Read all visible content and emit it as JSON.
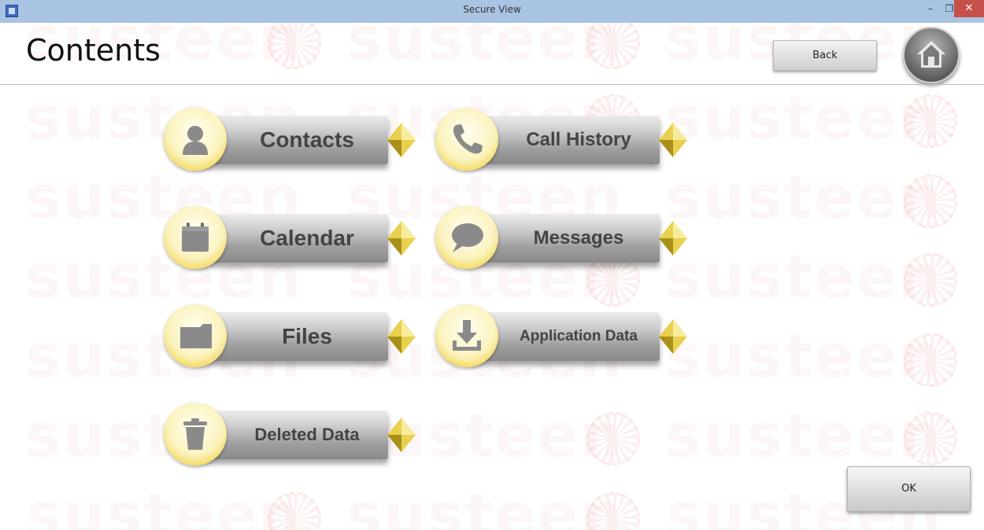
{
  "window": {
    "title": "Secure View",
    "minimize_glyph": "–",
    "maximize_glyph": "❐",
    "close_glyph": "✕"
  },
  "header": {
    "title": "Contents",
    "back_label": "Back",
    "home_icon": "home-icon"
  },
  "tiles": [
    {
      "label": "Contacts",
      "icon": "person-icon"
    },
    {
      "label": "Call History",
      "icon": "phone-icon"
    },
    {
      "label": "Calendar",
      "icon": "calendar-icon"
    },
    {
      "label": "Messages",
      "icon": "speech-bubble-icon"
    },
    {
      "label": "Files",
      "icon": "folder-icon"
    },
    {
      "label": "Application Data",
      "icon": "download-tray-icon"
    },
    {
      "label": "Deleted Data",
      "icon": "trash-icon"
    }
  ],
  "footer": {
    "ok_label": "OK"
  },
  "watermark": {
    "text": "susteen"
  },
  "colors": {
    "titlebar": "#a9c3e2",
    "tile_ring": "#f3d85a",
    "tile_bar": "#b5b5b5",
    "close_button": "#c7504b",
    "icon_gray": "#8a8a8a"
  }
}
